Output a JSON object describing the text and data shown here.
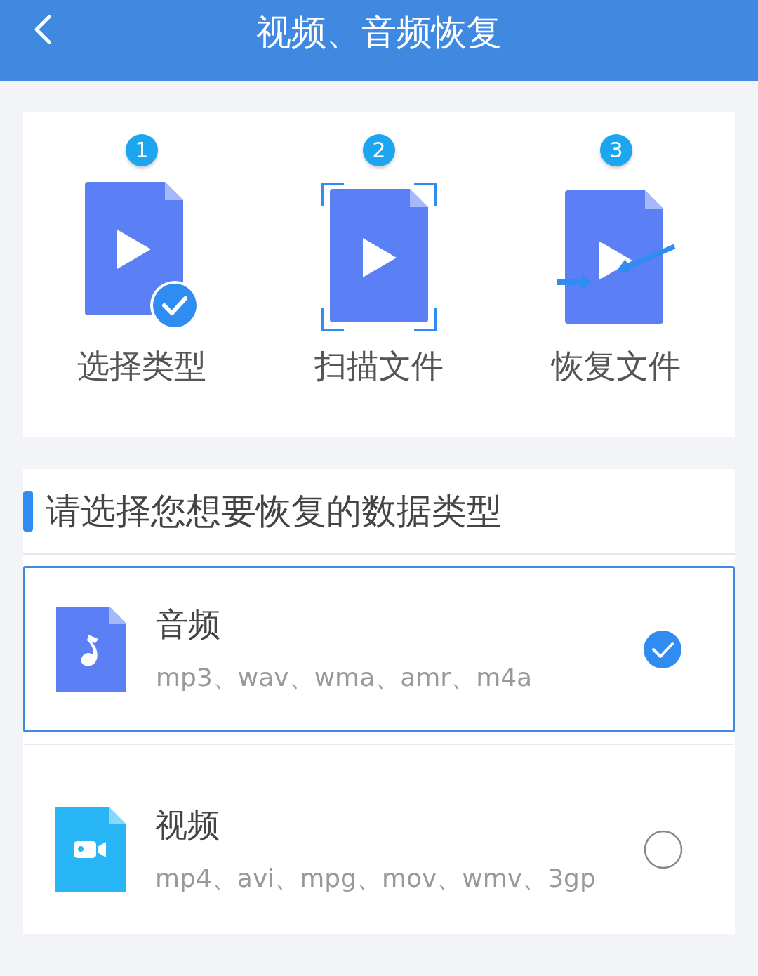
{
  "header": {
    "title": "视频、音频恢复"
  },
  "steps": [
    {
      "number": "1",
      "label": "选择类型",
      "kind": "select"
    },
    {
      "number": "2",
      "label": "扫描文件",
      "kind": "scan"
    },
    {
      "number": "3",
      "label": "恢复文件",
      "kind": "restore"
    }
  ],
  "section": {
    "title": "请选择您想要恢复的数据类型"
  },
  "options": [
    {
      "kind": "audio",
      "title": "音频",
      "formats": "mp3、wav、wma、amr、m4a",
      "selected": true
    },
    {
      "kind": "video",
      "title": "视频",
      "formats": "mp4、avi、mpg、mov、wmv、3gp",
      "selected": false
    }
  ]
}
